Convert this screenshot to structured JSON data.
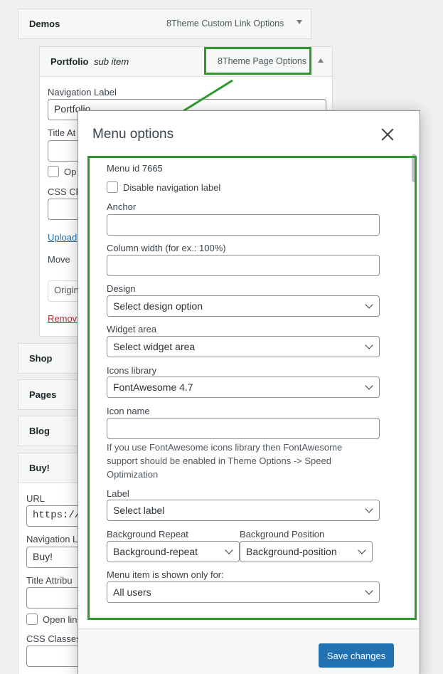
{
  "menu_items": {
    "demos": {
      "title": "Demos",
      "control": "8Theme Custom Link Options"
    },
    "portfolio": {
      "title": "Portfolio",
      "subtitle": "sub item",
      "control": "8Theme Page Options"
    },
    "shop": {
      "title": "Shop"
    },
    "pages": {
      "title": "Pages"
    },
    "blog": {
      "title": "Blog"
    },
    "buy": {
      "title": "Buy!"
    }
  },
  "portfolio_settings": {
    "nav_label": "Navigation Label",
    "nav_value": "Portfolio",
    "title_attr": "Title At",
    "open_label": "Op",
    "css_classes": "CSS Cl",
    "upload": "Upload",
    "move": "Move",
    "original": "Origina",
    "remove": "Remov"
  },
  "buy_settings": {
    "url_label": "URL",
    "url_value": "https://",
    "nav_label": "Navigation L",
    "nav_value": "Buy!",
    "title_attr": "Title Attribu",
    "open_label": "Open lin",
    "css_classes": "CSS Classes"
  },
  "modal": {
    "title": "Menu options",
    "menu_id": "Menu id 7665",
    "disable_nav_label": "Disable navigation label",
    "anchor_label": "Anchor",
    "column_width_label": "Column width (for ex.: 100%)",
    "design_label": "Design",
    "design_value": "Select design option",
    "widget_label": "Widget area",
    "widget_value": "Select widget area",
    "icons_lib_label": "Icons library",
    "icons_lib_value": "FontAwesome 4.7",
    "icon_name_label": "Icon name",
    "icon_help": "If you use FontAwesome icons library then FontAwesome support should be enabled in Theme Options -> Speed Optimization",
    "label_label": "Label",
    "label_value": "Select label",
    "bg_repeat_label": "Background Repeat",
    "bg_repeat_value": "Background-repeat",
    "bg_position_label": "Background Position",
    "bg_position_value": "Background-position",
    "shown_for_label": "Menu item is shown only for:",
    "shown_for_value": "All users",
    "save_label": "Save changes"
  },
  "colors": {
    "highlight": "#2e9a2e",
    "primary": "#2271b1"
  }
}
